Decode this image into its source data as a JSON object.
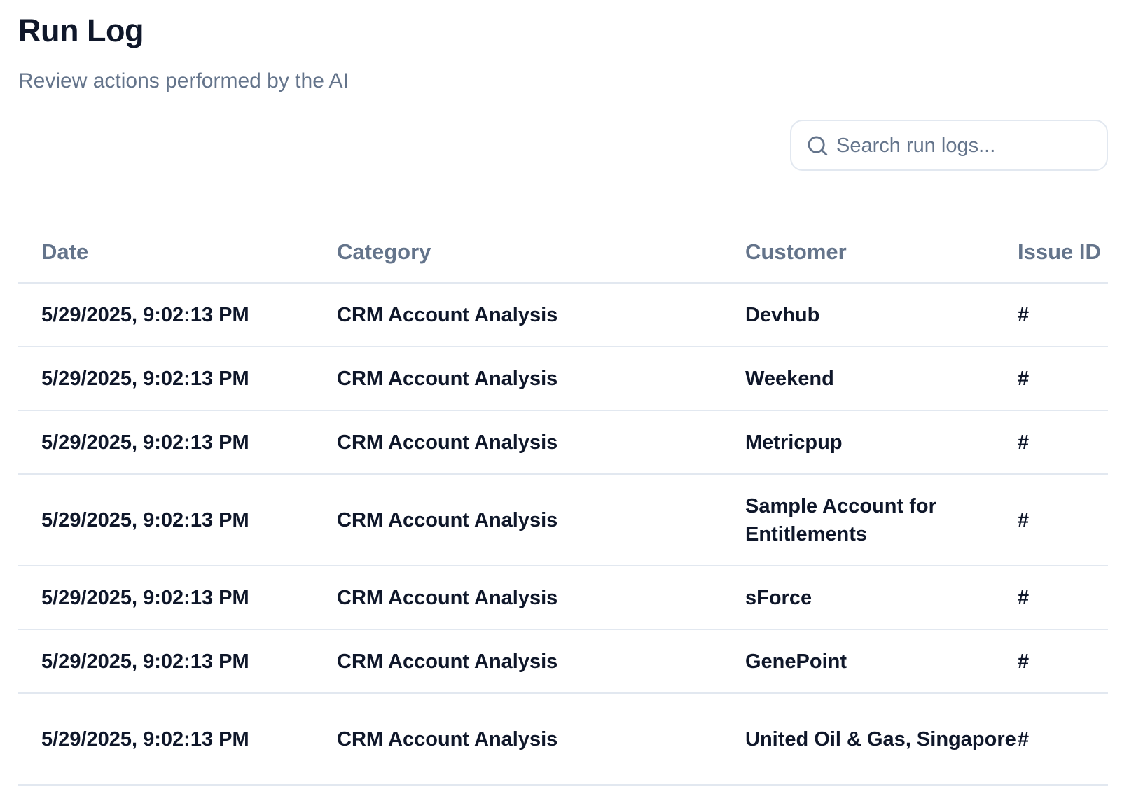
{
  "header": {
    "title": "Run Log",
    "subtitle": "Review actions performed by the AI"
  },
  "search": {
    "placeholder": "Search run logs...",
    "value": "",
    "icon": "search-icon"
  },
  "table": {
    "columns": [
      "Date",
      "Category",
      "Customer",
      "Issue ID"
    ],
    "rows": [
      {
        "date": "5/29/2025, 9:02:13 PM",
        "category": "CRM Account Analysis",
        "customer": "Devhub",
        "issue_id": "#"
      },
      {
        "date": "5/29/2025, 9:02:13 PM",
        "category": "CRM Account Analysis",
        "customer": "Weekend",
        "issue_id": "#"
      },
      {
        "date": "5/29/2025, 9:02:13 PM",
        "category": "CRM Account Analysis",
        "customer": "Metricpup",
        "issue_id": "#"
      },
      {
        "date": "5/29/2025, 9:02:13 PM",
        "category": "CRM Account Analysis",
        "customer": "Sample Account for Entitlements",
        "issue_id": "#"
      },
      {
        "date": "5/29/2025, 9:02:13 PM",
        "category": "CRM Account Analysis",
        "customer": "sForce",
        "issue_id": "#"
      },
      {
        "date": "5/29/2025, 9:02:13 PM",
        "category": "CRM Account Analysis",
        "customer": "GenePoint",
        "issue_id": "#"
      },
      {
        "date": "5/29/2025, 9:02:13 PM",
        "category": "CRM Account Analysis",
        "customer": "United Oil & Gas, Singapore",
        "issue_id": "#"
      }
    ]
  },
  "colors": {
    "title": "#0f172a",
    "muted": "#64748b",
    "border": "#e2e8f0"
  }
}
